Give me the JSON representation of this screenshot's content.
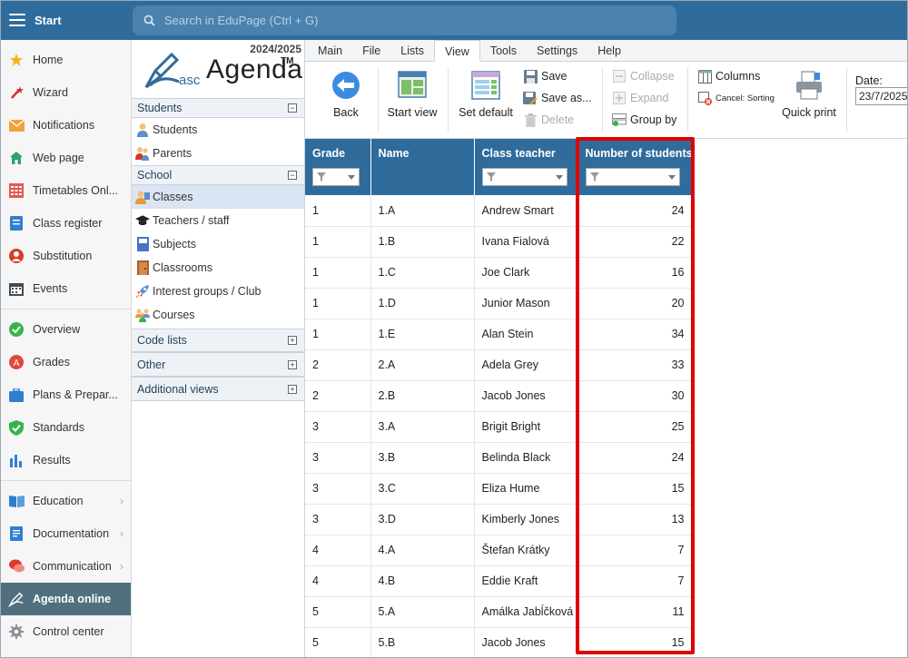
{
  "topbar": {
    "start_label": "Start",
    "search_placeholder": "Search in EduPage (Ctrl + G)"
  },
  "leftnav": {
    "items": [
      {
        "label": "Home",
        "icon": "star-icon"
      },
      {
        "label": "Wizard",
        "icon": "wand-icon"
      },
      {
        "label": "Notifications",
        "icon": "envelope-icon"
      },
      {
        "label": "Web page",
        "icon": "house-icon"
      },
      {
        "label": "Timetables Onl...",
        "icon": "timetable-icon"
      },
      {
        "label": "Class register",
        "icon": "register-icon"
      },
      {
        "label": "Substitution",
        "icon": "substitution-icon"
      },
      {
        "label": "Events",
        "icon": "calendar-icon"
      },
      {
        "label": "Overview",
        "icon": "check-circle-icon"
      },
      {
        "label": "Grades",
        "icon": "grades-icon"
      },
      {
        "label": "Plans & Prepar...",
        "icon": "briefcase-icon"
      },
      {
        "label": "Standards",
        "icon": "shield-check-icon"
      },
      {
        "label": "Results",
        "icon": "bar-chart-icon"
      },
      {
        "label": "Education",
        "icon": "book-icon"
      },
      {
        "label": "Documentation",
        "icon": "document-icon"
      },
      {
        "label": "Communication",
        "icon": "chat-icon"
      },
      {
        "label": "Agenda online",
        "icon": "agenda-pen-icon"
      },
      {
        "label": "Control center",
        "icon": "gear-icon"
      }
    ]
  },
  "panel2": {
    "year": "2024/2025",
    "logo_asc": "asc",
    "logo_agenda": "Agenda",
    "logo_tm": "TM",
    "sections": {
      "students": {
        "title": "Students",
        "items": [
          "Students",
          "Parents"
        ]
      },
      "school": {
        "title": "School",
        "items": [
          "Classes",
          "Teachers / staff",
          "Subjects",
          "Classrooms",
          "Interest groups / Club",
          "Courses"
        ]
      },
      "code_lists": "Code lists",
      "other": "Other",
      "additional_views": "Additional views"
    },
    "toggle_minus": "−",
    "toggle_plus": "+"
  },
  "tabs": [
    "Main",
    "File",
    "Lists",
    "View",
    "Tools",
    "Settings",
    "Help"
  ],
  "ribbon": {
    "back": "Back",
    "start_view": "Start view",
    "set_default": "Set default",
    "save": "Save",
    "save_as": "Save as...",
    "delete": "Delete",
    "collapse": "Collapse",
    "expand": "Expand",
    "group_by": "Group by",
    "columns": "Columns",
    "cancel_sorting": "Cancel: Sorting",
    "quick_print": "Quick print",
    "date_label": "Date:",
    "date_value": "23/7/2025"
  },
  "table": {
    "headers": [
      "Grade",
      "Name",
      "Class teacher",
      "Number of students"
    ],
    "rows": [
      [
        "1",
        "1.A",
        "Andrew Smart",
        "24"
      ],
      [
        "1",
        "1.B",
        "Ivana Fialová",
        "22"
      ],
      [
        "1",
        "1.C",
        "Joe Clark",
        "16"
      ],
      [
        "1",
        "1.D",
        "Junior Mason",
        "20"
      ],
      [
        "1",
        "1.E",
        "Alan Stein",
        "34"
      ],
      [
        "2",
        "2.A",
        "Adela Grey",
        "33"
      ],
      [
        "2",
        "2.B",
        "Jacob Jones",
        "30"
      ],
      [
        "3",
        "3.A",
        "Brigit Bright",
        "25"
      ],
      [
        "3",
        "3.B",
        "Belinda Black",
        "24"
      ],
      [
        "3",
        "3.C",
        "Eliza Hume",
        "15"
      ],
      [
        "3",
        "3.D",
        "Kimberly Jones",
        "13"
      ],
      [
        "4",
        "4.A",
        "Štefan Krátky",
        "7"
      ],
      [
        "4",
        "4.B",
        "Eddie Kraft",
        "7"
      ],
      [
        "5",
        "5.A",
        "Amálka Jabĺčková",
        "11"
      ],
      [
        "5",
        "5.B",
        "Jacob Jones",
        "15"
      ]
    ]
  },
  "colors": {
    "topbar": "#2f6c9c",
    "header": "#2f6c9c",
    "highlight": "#e00000",
    "active_nav": "#50707f"
  }
}
